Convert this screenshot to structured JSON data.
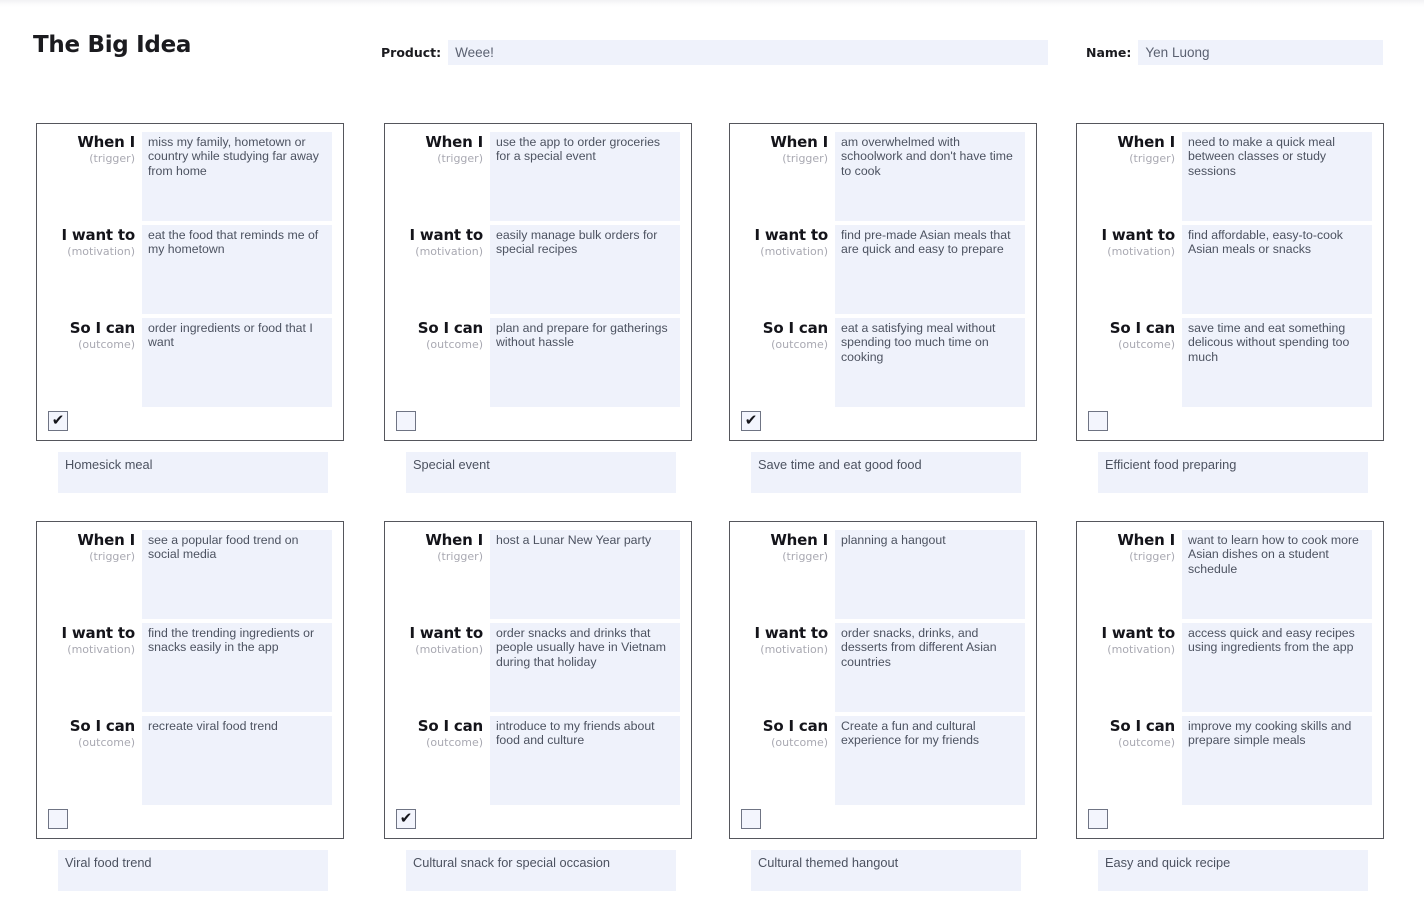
{
  "header": {
    "title": "The Big Idea",
    "product_label": "Product:",
    "product_value": "Weee!",
    "name_label": "Name:",
    "name_value": "Yen Luong"
  },
  "labels": {
    "trigger_main": "When I",
    "trigger_sub": "(trigger)",
    "motivation_main": "I want to",
    "motivation_sub": "(motivation)",
    "outcome_main": "So I can",
    "outcome_sub": "(outcome)"
  },
  "icons": {
    "check": "✔"
  },
  "colors": {
    "field_fill": "#eff2fb",
    "card_border": "#55565c",
    "answer_text": "#4c5260",
    "sub_label": "#a9a9b2"
  },
  "cards": [
    {
      "trigger": "miss my family, hometown or country while studying far away from home",
      "motivation": "eat the food that reminds me of my hometown",
      "outcome": "order ingredients or food that I want",
      "checked": true,
      "caption": "Homesick meal"
    },
    {
      "trigger": "use the app to order groceries for a special event",
      "motivation": "easily manage bulk orders for  special recipes",
      "outcome": "plan and prepare for gatherings without hassle",
      "checked": false,
      "caption": "Special event"
    },
    {
      "trigger": "am overwhelmed with schoolwork and don't have time to cook",
      "motivation": "find pre-made Asian meals that are quick and easy to prepare",
      "outcome": "eat a satisfying meal without spending too much time on cooking",
      "checked": true,
      "caption": "Save time and eat good food"
    },
    {
      "trigger": "need to make a quick meal between classes or study sessions",
      "motivation": "find affordable, easy-to-cook Asian meals or snacks",
      "outcome": "save time and eat something delicous without spending too  much",
      "checked": false,
      "caption": "Efficient food preparing"
    },
    {
      "trigger": "see a popular food trend on social media",
      "motivation": "find the trending ingredients or snacks easily in the app",
      "outcome": "recreate viral food trend",
      "checked": false,
      "caption": "Viral food trend"
    },
    {
      "trigger": "host a Lunar New Year party",
      "motivation": "order snacks and drinks that people usually have in Vietnam during that holiday",
      "outcome": "introduce to my friends about food and culture",
      "checked": true,
      "caption": "Cultural snack for special occasion"
    },
    {
      "trigger": "planning a hangout",
      "motivation": "order snacks, drinks, and desserts from different Asian countries",
      "outcome": "Create a fun and cultural experience for my friends",
      "checked": false,
      "caption": "Cultural themed hangout"
    },
    {
      "trigger": "want to learn how to cook more Asian dishes on a student schedule",
      "motivation": "access quick and easy recipes using ingredients from the app",
      "outcome": "improve my cooking skills and prepare simple meals",
      "checked": false,
      "caption": "Easy and quick recipe"
    }
  ]
}
